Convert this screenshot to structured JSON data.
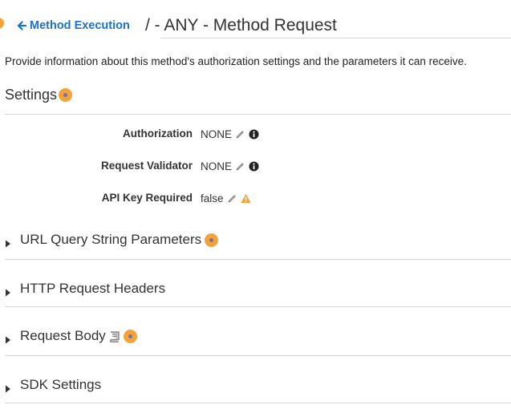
{
  "header": {
    "back_label": "Method Execution",
    "title": "/ - ANY - Method Request"
  },
  "description": "Provide information about this method's authorization settings and the parameters it can receive.",
  "settings": {
    "title": "Settings",
    "rows": [
      {
        "label": "Authorization",
        "value": "NONE",
        "edit_icon": "pencil-icon",
        "status_icon": "info-circle-icon"
      },
      {
        "label": "Request Validator",
        "value": "NONE",
        "edit_icon": "pencil-icon",
        "status_icon": "info-circle-icon"
      },
      {
        "label": "API Key Required",
        "value": "false",
        "edit_icon": "pencil-icon",
        "status_icon": "warning-triangle-icon"
      }
    ]
  },
  "sections": [
    {
      "label": "URL Query String Parameters",
      "has_info": true,
      "has_book": false
    },
    {
      "label": "HTTP Request Headers",
      "has_info": false,
      "has_book": false
    },
    {
      "label": "Request Body",
      "has_info": true,
      "has_book": true
    },
    {
      "label": "SDK Settings",
      "has_info": false,
      "has_book": false
    }
  ],
  "colors": {
    "accent_orange": "#f2a33a",
    "link_blue": "#1a73c8",
    "text": "#333333",
    "rule": "#d6d6d6"
  }
}
